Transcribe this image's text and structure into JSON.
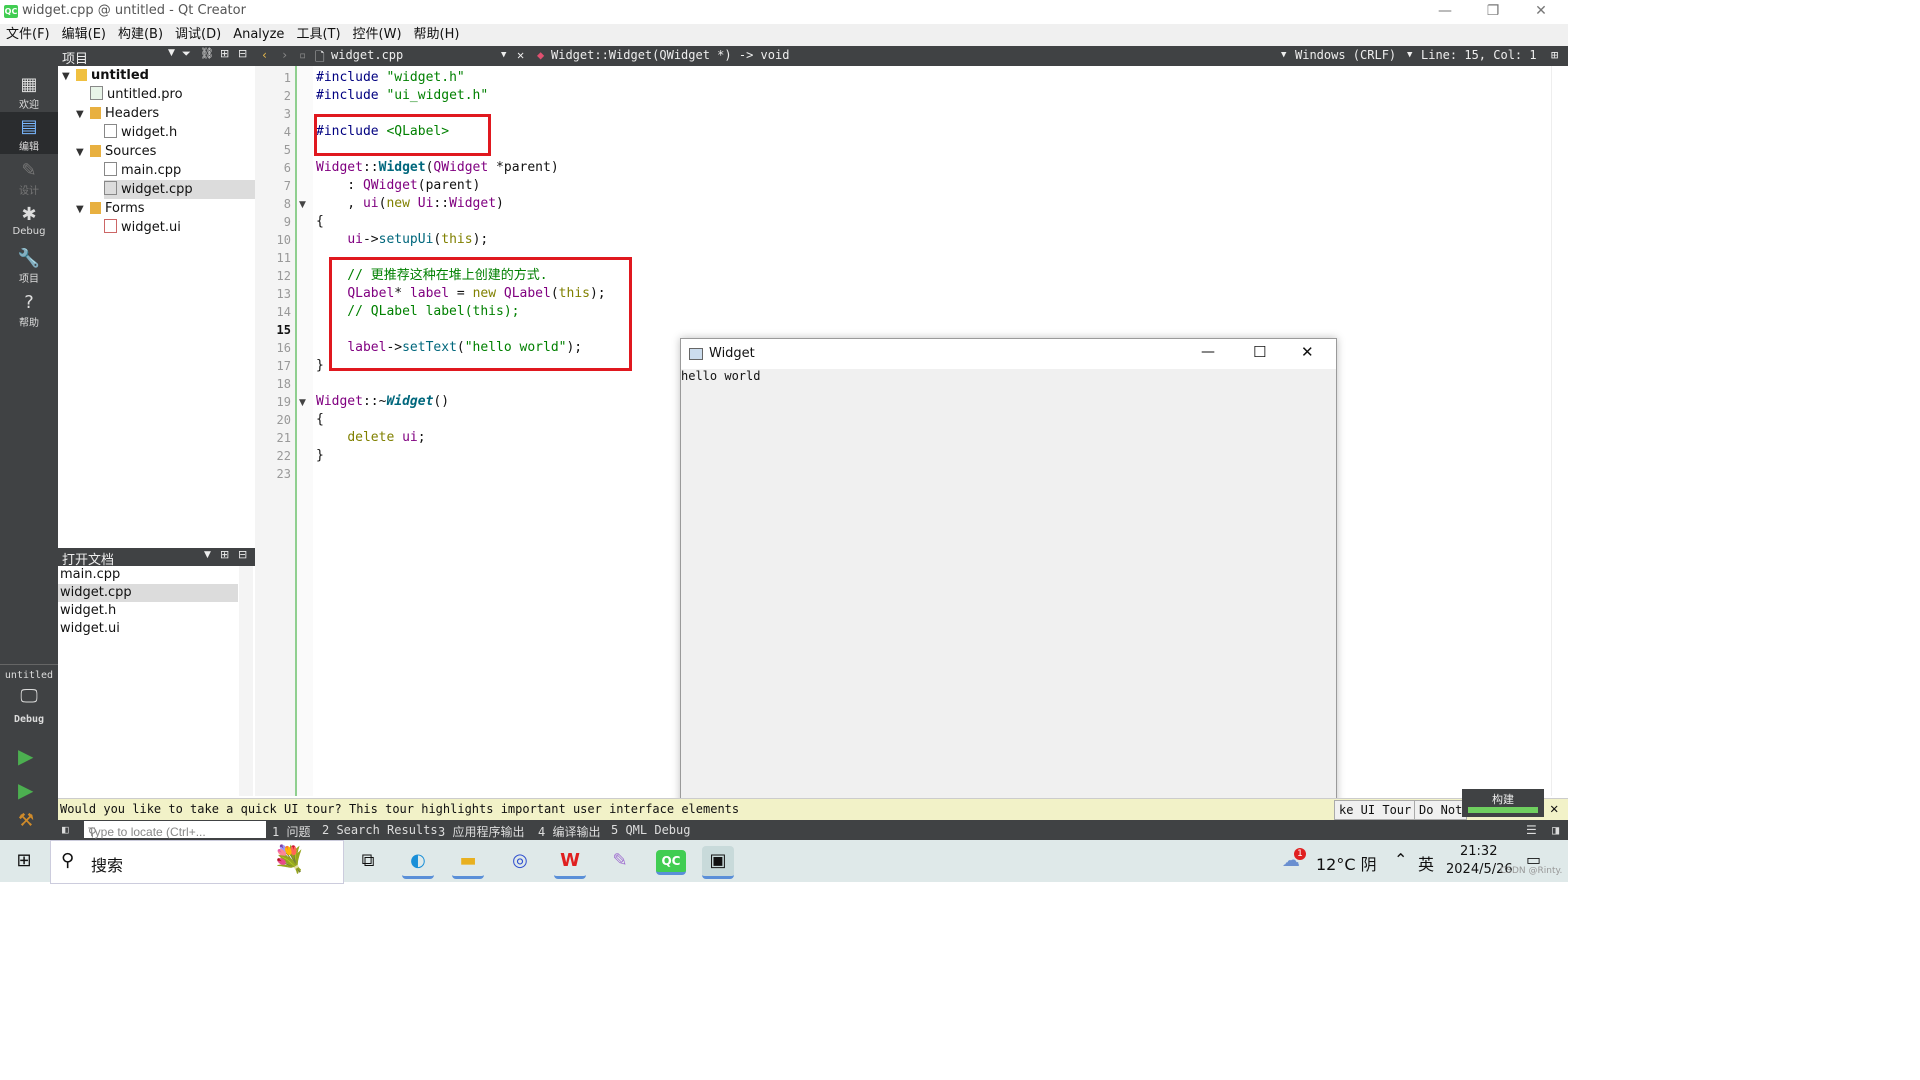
{
  "window": {
    "title": "widget.cpp @ untitled - Qt Creator",
    "logo": "QC"
  },
  "menu": [
    "文件(F)",
    "编辑(E)",
    "构建(B)",
    "调试(D)",
    "Analyze",
    "工具(T)",
    "控件(W)",
    "帮助(H)"
  ],
  "modes": [
    {
      "label": "欢迎",
      "icon": "grid-icon"
    },
    {
      "label": "编辑",
      "icon": "edit-icon"
    },
    {
      "label": "设计",
      "icon": "pencil-icon"
    },
    {
      "label": "Debug",
      "icon": "bug-icon"
    },
    {
      "label": "项目",
      "icon": "wrench-icon"
    },
    {
      "label": "帮助",
      "icon": "help-icon"
    }
  ],
  "kit": {
    "project": "untitled",
    "build": "Debug"
  },
  "project_pane": {
    "title": "项目"
  },
  "tree": [
    {
      "label": "untitled",
      "depth": 0,
      "expanded": true,
      "bold": true
    },
    {
      "label": "untitled.pro",
      "depth": 1
    },
    {
      "label": "Headers",
      "depth": 1,
      "expanded": true
    },
    {
      "label": "widget.h",
      "depth": 2
    },
    {
      "label": "Sources",
      "depth": 1,
      "expanded": true
    },
    {
      "label": "main.cpp",
      "depth": 2
    },
    {
      "label": "widget.cpp",
      "depth": 2,
      "selected": true
    },
    {
      "label": "Forms",
      "depth": 1,
      "expanded": true
    },
    {
      "label": "widget.ui",
      "depth": 2
    }
  ],
  "open_docs": {
    "title": "打开文档",
    "items": [
      "main.cpp",
      "widget.cpp",
      "widget.h",
      "widget.ui"
    ],
    "selected": 1
  },
  "editor": {
    "file": "widget.cpp",
    "symbol": "Widget::Widget(QWidget *) -> void",
    "line_ending": "Windows (CRLF)",
    "position": "Line: 15, Col: 1",
    "current_line": 15,
    "lines": [
      "#include \"widget.h\"",
      "#include \"ui_widget.h\"",
      "",
      "#include <QLabel>",
      "",
      "Widget::Widget(QWidget *parent)",
      "    : QWidget(parent)",
      "    , ui(new Ui::Widget)",
      "{",
      "    ui->setupUi(this);",
      "",
      "    // 更推荐这种在堆上创建的方式.",
      "    QLabel* label = new QLabel(this);",
      "    // QLabel label(this);",
      "",
      "    label->setText(\"hello world\");",
      "}",
      "",
      "Widget::~Widget()",
      "{",
      "    delete ui;",
      "}",
      ""
    ]
  },
  "widget_window": {
    "title": "Widget",
    "label_text": "hello world"
  },
  "tour_bar": {
    "message": "Would you like to take a quick UI tour? This tour highlights important user interface elements",
    "take_tour": "ke UI Tour",
    "do_not": "Do Not"
  },
  "build_progress": {
    "label": "构建",
    "value": 1.0
  },
  "locator": {
    "placeholder": "Type to locate (Ctrl+..."
  },
  "output_panes": [
    "1 问题",
    "2 Search Results",
    "3 应用程序输出",
    "4 编译输出",
    "5 QML Debug"
  ],
  "taskbar": {
    "search": "搜索",
    "weather": "12°C 阴",
    "ime": "英",
    "time": "21:32",
    "date": "2024/5/26",
    "badge": "1",
    "watermark": "CSDN @Rinty."
  }
}
